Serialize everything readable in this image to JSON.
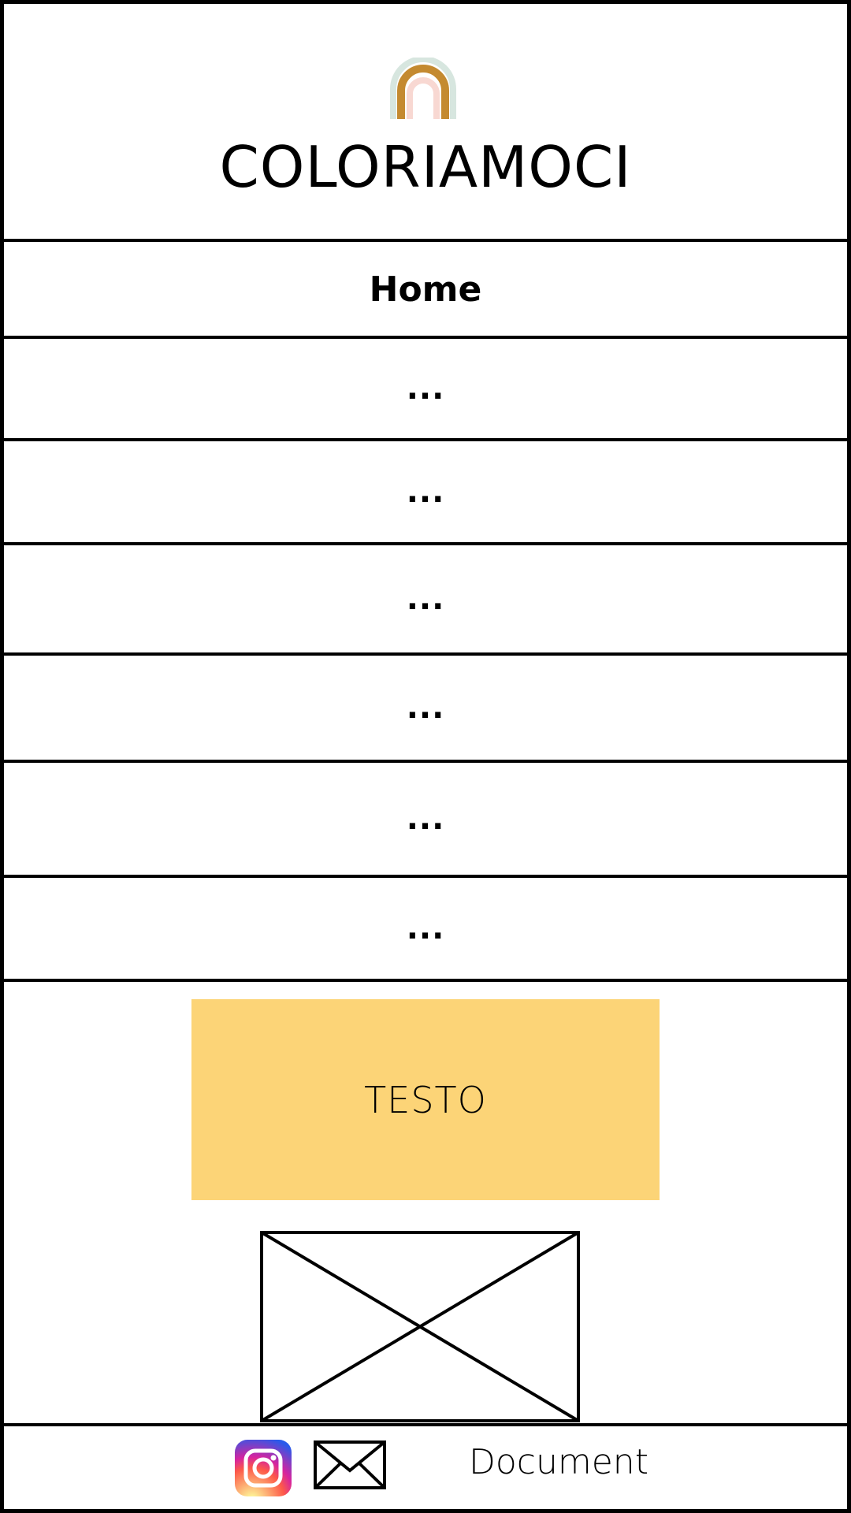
{
  "header": {
    "logo_icon": "rainbow-logo",
    "title": "COLORIAMOCI"
  },
  "nav": {
    "items": [
      {
        "label": "Home"
      },
      {
        "label": "..."
      },
      {
        "label": "..."
      },
      {
        "label": "..."
      },
      {
        "label": "..."
      },
      {
        "label": "..."
      },
      {
        "label": "..."
      }
    ]
  },
  "content": {
    "text_block": "TESTO",
    "text_block_color": "#fcd477",
    "image_placeholder_icon": "image-placeholder-icon"
  },
  "footer": {
    "instagram_icon": "instagram-icon",
    "mail_icon": "mail-icon",
    "document_label": "Document"
  }
}
